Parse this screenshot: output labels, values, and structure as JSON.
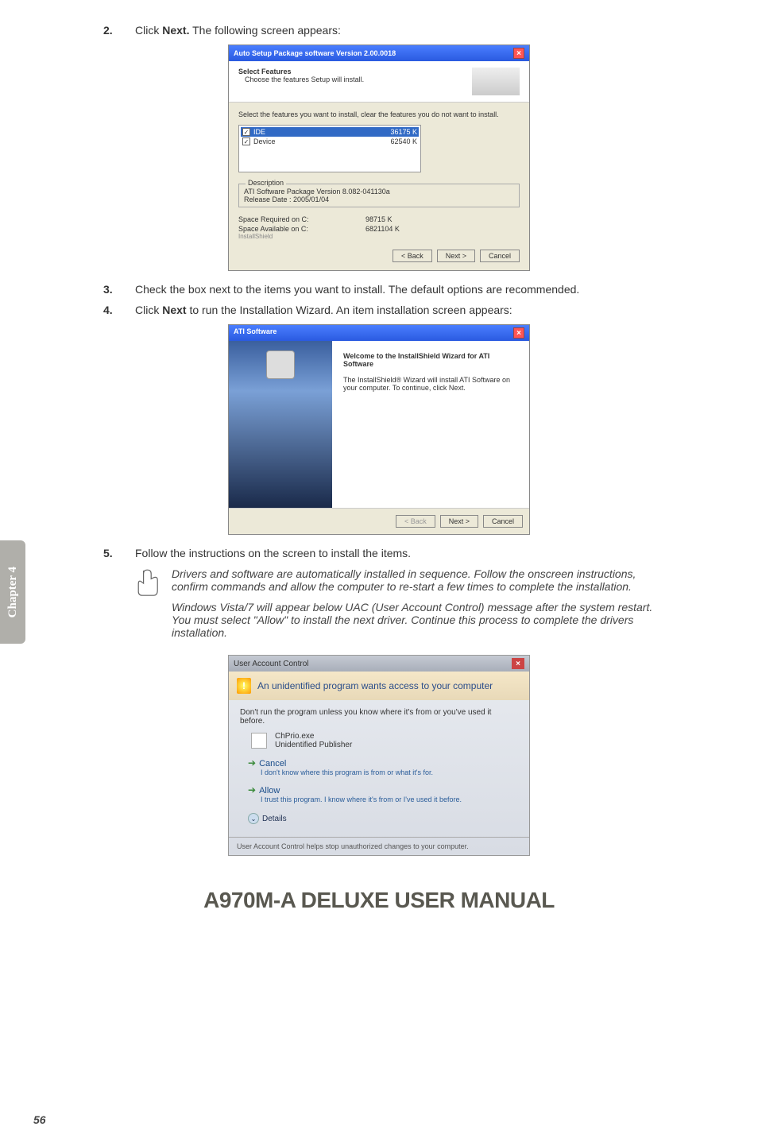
{
  "steps": {
    "s2": {
      "num": "2.",
      "text_pre": "Click ",
      "bold": "Next.",
      "text_post": " The following screen appears:"
    },
    "s3": {
      "num": "3.",
      "text": "Check the box next to the items you want to install. The default options are recommended."
    },
    "s4": {
      "num": "4.",
      "text_pre": "Click ",
      "bold": "Next",
      "text_post": " to run the Installation Wizard. An item installation screen appears:"
    },
    "s5": {
      "num": "5.",
      "text": "Follow the instructions on the screen to install the items."
    }
  },
  "chapter_tab": "Chapter 4",
  "dlg1": {
    "title": "Auto Setup Package software Version 2.00.0018",
    "header": "Select Features",
    "subheader": "Choose the features Setup will install.",
    "instruct": "Select the features you want to install, clear the features you do not want to install.",
    "features": {
      "ide": {
        "name": "IDE",
        "size": "36175 K"
      },
      "device": {
        "name": "Device",
        "size": "62540 K"
      }
    },
    "desc_label": "Description",
    "desc_line1": "ATI Software Package Version 8.082-041130a",
    "desc_line2": "Release Date : 2005/01/04",
    "space_req_label": "Space Required on  C:",
    "space_req_val": "98715 K",
    "space_avail_label": "Space Available on  C:",
    "space_avail_val": "6821104 K",
    "installshield": "InstallShield",
    "btn_back": "< Back",
    "btn_next": "Next >",
    "btn_cancel": "Cancel"
  },
  "dlg2": {
    "title": "ATI Software",
    "heading": "Welcome to the InstallShield Wizard for ATI Software",
    "body": "The InstallShield® Wizard will install ATI Software on your computer.  To continue, click Next.",
    "btn_back": "< Back",
    "btn_next": "Next >",
    "btn_cancel": "Cancel"
  },
  "note": {
    "p1": "Drivers and software are automatically installed in sequence. Follow the onscreen instructions, confirm commands and allow the computer to re-start a few times to complete the installation.",
    "p2": "Windows Vista/7 will appear below UAC (User Account Control) message after the system restart. You must select \"Allow\" to install the next driver. Continue this process to complete the drivers installation."
  },
  "uac": {
    "title": "User Account Control",
    "headline": "An unidentified program wants access to your computer",
    "warn": "Don't run the program unless you know where it's from or you've used it before.",
    "prog_name": "ChPrio.exe",
    "prog_pub": "Unidentified Publisher",
    "cancel_title": "Cancel",
    "cancel_desc": "I don't know where this program is from or what it's for.",
    "allow_title": "Allow",
    "allow_desc": "I trust this program. I know where it's from or I've used it before.",
    "details": "Details",
    "footer": "User Account Control helps stop unauthorized changes to your computer."
  },
  "manual_title": "A970M-A DELUXE USER MANUAL",
  "page_number": "56"
}
